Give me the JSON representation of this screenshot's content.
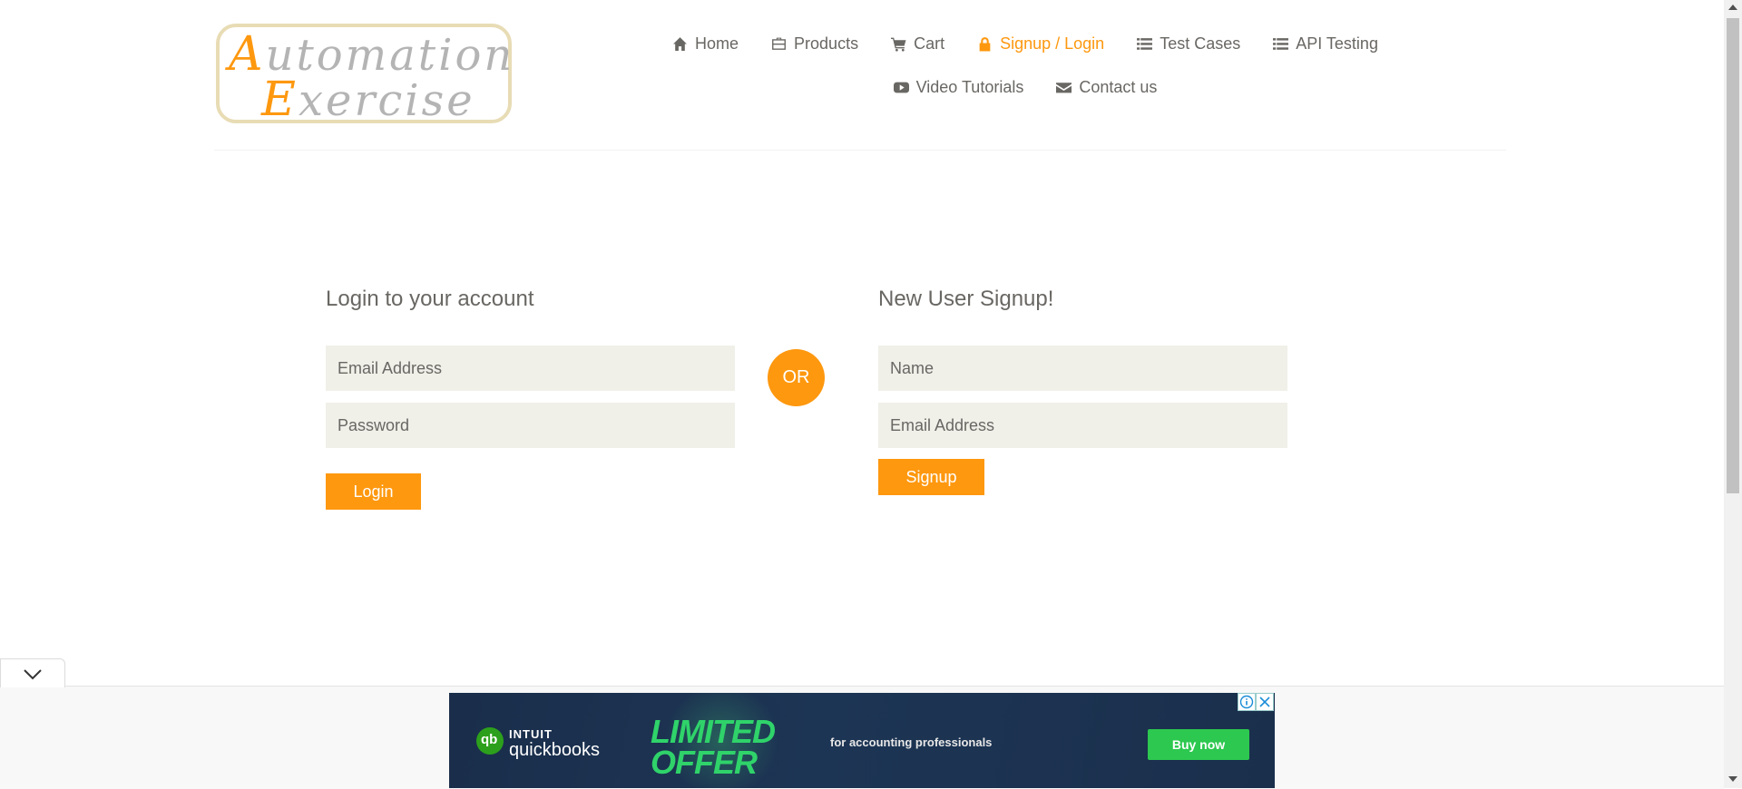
{
  "logo": {
    "line1_cap": "A",
    "line1_rest": "utomation",
    "line2_cap": "E",
    "line2_rest": "xercise"
  },
  "nav": {
    "items": [
      {
        "label": "Home",
        "icon": "home-icon"
      },
      {
        "label": "Products",
        "icon": "briefcase-icon"
      },
      {
        "label": "Cart",
        "icon": "cart-icon"
      },
      {
        "label": "Signup / Login",
        "icon": "lock-icon",
        "active": true
      },
      {
        "label": "Test Cases",
        "icon": "list-icon"
      },
      {
        "label": "API Testing",
        "icon": "list-icon"
      },
      {
        "label": "Video Tutorials",
        "icon": "youtube-icon"
      },
      {
        "label": "Contact us",
        "icon": "envelope-icon"
      }
    ]
  },
  "login": {
    "title": "Login to your account",
    "email_placeholder": "Email Address",
    "password_placeholder": "Password",
    "button": "Login"
  },
  "divider": {
    "or": "OR"
  },
  "signup": {
    "title": "New User Signup!",
    "name_placeholder": "Name",
    "email_placeholder": "Email Address",
    "button": "Signup"
  },
  "ad": {
    "brand_small": "INTUIT",
    "brand_name": "quickbooks",
    "brand_mark": "qb",
    "offer": "LIMITED OFFER",
    "tagline": "for accounting professionals",
    "cta": "Buy now"
  },
  "colors": {
    "accent": "#fe980f",
    "text": "#696763",
    "field_bg": "#f0f0e9",
    "ad_bg": "#1a2e4b",
    "ad_green": "#2cc84f"
  }
}
